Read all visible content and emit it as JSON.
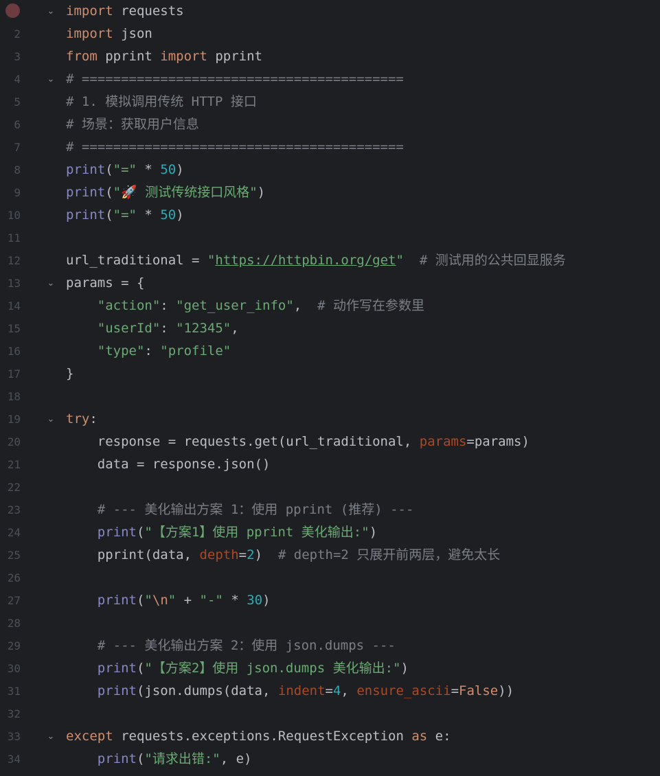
{
  "editor": {
    "colors": {
      "background": "#1e1f22",
      "keyword": "#cf8e6d",
      "builtin": "#8888c6",
      "string": "#6aab73",
      "number": "#2aacb8",
      "comment": "#7a7e85",
      "param": "#aa4926",
      "text": "#bcbec4",
      "line_number": "#4b5059",
      "breakpoint": "#6e3b40"
    },
    "breakpoint_line": 1,
    "lines": [
      {
        "num": "1",
        "fold": "chevron-down-icon",
        "tokens": [
          [
            "kw",
            "import"
          ],
          [
            "tx",
            " requests"
          ]
        ]
      },
      {
        "num": "2",
        "fold": "",
        "tokens": [
          [
            "kw",
            "import"
          ],
          [
            "tx",
            " json"
          ]
        ]
      },
      {
        "num": "3",
        "fold": "",
        "tokens": [
          [
            "kw",
            "from"
          ],
          [
            "tx",
            " pprint "
          ],
          [
            "kw",
            "import"
          ],
          [
            "tx",
            " pprint"
          ]
        ]
      },
      {
        "num": "4",
        "fold": "chevron-down-icon",
        "tokens": [
          [
            "cm",
            "# ========================================="
          ]
        ]
      },
      {
        "num": "5",
        "fold": "",
        "tokens": [
          [
            "cm",
            "# 1. 模拟调用传统 HTTP 接口"
          ]
        ]
      },
      {
        "num": "6",
        "fold": "",
        "tokens": [
          [
            "cm",
            "# 场景：获取用户信息"
          ]
        ]
      },
      {
        "num": "7",
        "fold": "",
        "tokens": [
          [
            "cm",
            "# ========================================="
          ]
        ]
      },
      {
        "num": "8",
        "fold": "",
        "tokens": [
          [
            "bi",
            "print"
          ],
          [
            "tx",
            "("
          ],
          [
            "str",
            "\"=\""
          ],
          [
            "tx",
            " * "
          ],
          [
            "num",
            "50"
          ],
          [
            "tx",
            ")"
          ]
        ]
      },
      {
        "num": "9",
        "fold": "",
        "tokens": [
          [
            "bi",
            "print"
          ],
          [
            "tx",
            "("
          ],
          [
            "str",
            "\""
          ],
          [
            "emoji",
            "🚀"
          ],
          [
            "str",
            " 测试传统接口风格\""
          ],
          [
            "tx",
            ")"
          ]
        ]
      },
      {
        "num": "10",
        "fold": "",
        "tokens": [
          [
            "bi",
            "print"
          ],
          [
            "tx",
            "("
          ],
          [
            "str",
            "\"=\""
          ],
          [
            "tx",
            " * "
          ],
          [
            "num",
            "50"
          ],
          [
            "tx",
            ")"
          ]
        ]
      },
      {
        "num": "11",
        "fold": "",
        "tokens": []
      },
      {
        "num": "12",
        "fold": "",
        "tokens": [
          [
            "tx",
            "url_traditional = "
          ],
          [
            "str",
            "\""
          ],
          [
            "url",
            "https://httpbin.org/get"
          ],
          [
            "str",
            "\""
          ],
          [
            "tx",
            "  "
          ],
          [
            "cm",
            "# 测试用的公共回显服务"
          ]
        ]
      },
      {
        "num": "13",
        "fold": "chevron-down-icon",
        "tokens": [
          [
            "tx",
            "params = {"
          ]
        ]
      },
      {
        "num": "14",
        "fold": "",
        "tokens": [
          [
            "tx",
            "    "
          ],
          [
            "str",
            "\"action\""
          ],
          [
            "tx",
            ": "
          ],
          [
            "str",
            "\"get_user_info\""
          ],
          [
            "tx",
            ",  "
          ],
          [
            "cm",
            "# 动作写在参数里"
          ]
        ]
      },
      {
        "num": "15",
        "fold": "",
        "tokens": [
          [
            "tx",
            "    "
          ],
          [
            "str",
            "\"userId\""
          ],
          [
            "tx",
            ": "
          ],
          [
            "str",
            "\"12345\""
          ],
          [
            "tx",
            ","
          ]
        ]
      },
      {
        "num": "16",
        "fold": "",
        "tokens": [
          [
            "tx",
            "    "
          ],
          [
            "str",
            "\"type\""
          ],
          [
            "tx",
            ": "
          ],
          [
            "str",
            "\"profile\""
          ]
        ]
      },
      {
        "num": "17",
        "fold": "",
        "tokens": [
          [
            "tx",
            "}"
          ]
        ]
      },
      {
        "num": "18",
        "fold": "",
        "tokens": []
      },
      {
        "num": "19",
        "fold": "chevron-down-icon",
        "tokens": [
          [
            "kw",
            "try"
          ],
          [
            "tx",
            ":"
          ]
        ]
      },
      {
        "num": "20",
        "fold": "",
        "tokens": [
          [
            "tx",
            "    response = requests.get(url_traditional, "
          ],
          [
            "par",
            "params"
          ],
          [
            "tx",
            "=params)"
          ]
        ]
      },
      {
        "num": "21",
        "fold": "",
        "tokens": [
          [
            "tx",
            "    data = response.json()"
          ]
        ]
      },
      {
        "num": "22",
        "fold": "",
        "tokens": []
      },
      {
        "num": "23",
        "fold": "",
        "tokens": [
          [
            "tx",
            "    "
          ],
          [
            "cm",
            "# --- 美化输出方案 1：使用 pprint (推荐) ---"
          ]
        ]
      },
      {
        "num": "24",
        "fold": "",
        "tokens": [
          [
            "tx",
            "    "
          ],
          [
            "bi",
            "print"
          ],
          [
            "tx",
            "("
          ],
          [
            "str",
            "\"【方案1】使用 pprint 美化输出:\""
          ],
          [
            "tx",
            ")"
          ]
        ]
      },
      {
        "num": "25",
        "fold": "",
        "tokens": [
          [
            "tx",
            "    pprint(data, "
          ],
          [
            "par",
            "depth"
          ],
          [
            "tx",
            "="
          ],
          [
            "num",
            "2"
          ],
          [
            "tx",
            ")  "
          ],
          [
            "cm",
            "# depth=2 只展开前两层，避免太长"
          ]
        ]
      },
      {
        "num": "26",
        "fold": "",
        "tokens": []
      },
      {
        "num": "27",
        "fold": "",
        "tokens": [
          [
            "tx",
            "    "
          ],
          [
            "bi",
            "print"
          ],
          [
            "tx",
            "("
          ],
          [
            "str",
            "\""
          ],
          [
            "esc",
            "\\n"
          ],
          [
            "str",
            "\""
          ],
          [
            "tx",
            " + "
          ],
          [
            "str",
            "\"-\""
          ],
          [
            "tx",
            " * "
          ],
          [
            "num",
            "30"
          ],
          [
            "tx",
            ")"
          ]
        ]
      },
      {
        "num": "28",
        "fold": "",
        "tokens": []
      },
      {
        "num": "29",
        "fold": "",
        "tokens": [
          [
            "tx",
            "    "
          ],
          [
            "cm",
            "# --- 美化输出方案 2：使用 json.dumps ---"
          ]
        ]
      },
      {
        "num": "30",
        "fold": "",
        "tokens": [
          [
            "tx",
            "    "
          ],
          [
            "bi",
            "print"
          ],
          [
            "tx",
            "("
          ],
          [
            "str",
            "\"【方案2】使用 json.dumps 美化输出:\""
          ],
          [
            "tx",
            ")"
          ]
        ]
      },
      {
        "num": "31",
        "fold": "",
        "tokens": [
          [
            "tx",
            "    "
          ],
          [
            "bi",
            "print"
          ],
          [
            "tx",
            "(json.dumps(data, "
          ],
          [
            "par",
            "indent"
          ],
          [
            "tx",
            "="
          ],
          [
            "num",
            "4"
          ],
          [
            "tx",
            ", "
          ],
          [
            "par",
            "ensure_ascii"
          ],
          [
            "tx",
            "="
          ],
          [
            "kw",
            "False"
          ],
          [
            "tx",
            "))"
          ]
        ]
      },
      {
        "num": "32",
        "fold": "",
        "tokens": []
      },
      {
        "num": "33",
        "fold": "chevron-down-icon",
        "tokens": [
          [
            "kw",
            "except"
          ],
          [
            "tx",
            " requests.exceptions.RequestException "
          ],
          [
            "kw",
            "as"
          ],
          [
            "tx",
            " e:"
          ]
        ]
      },
      {
        "num": "34",
        "fold": "",
        "tokens": [
          [
            "tx",
            "    "
          ],
          [
            "bi",
            "print"
          ],
          [
            "tx",
            "("
          ],
          [
            "str",
            "\"请求出错:\""
          ],
          [
            "tx",
            ", e)"
          ]
        ]
      }
    ]
  }
}
